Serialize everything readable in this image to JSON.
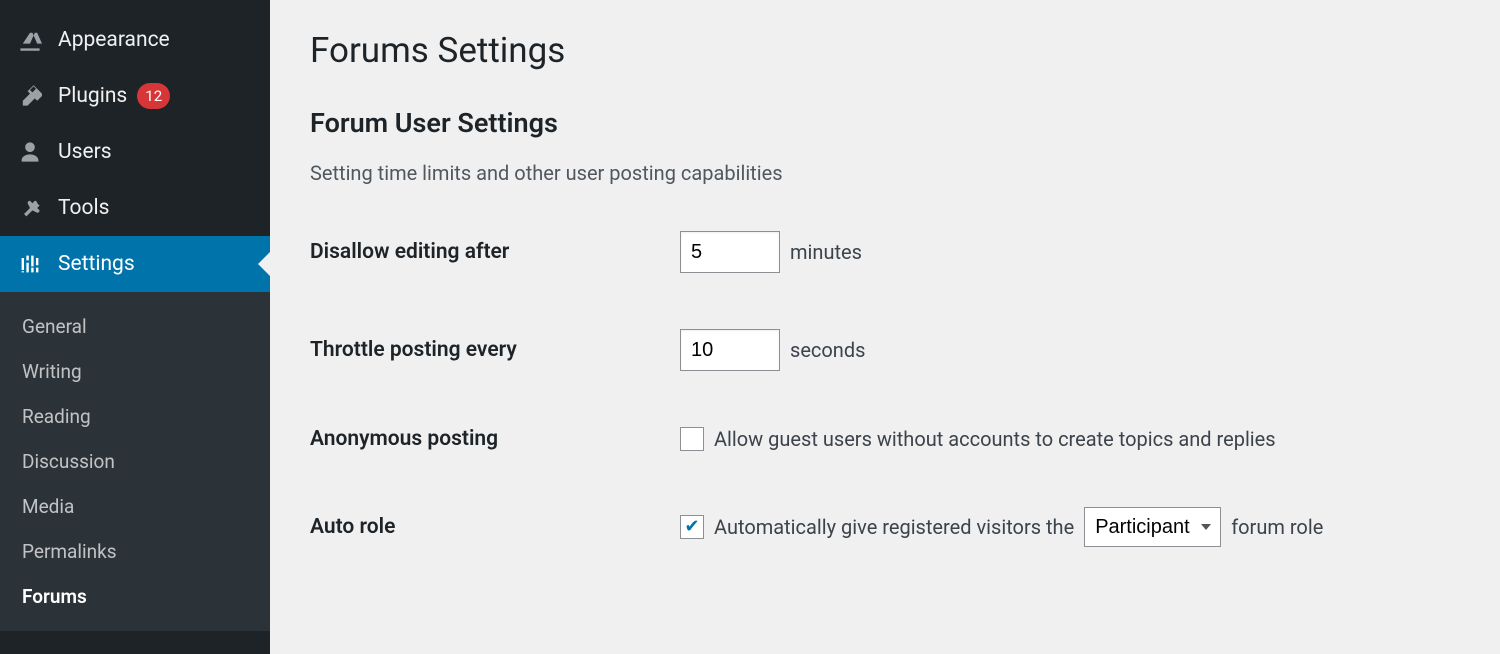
{
  "sidebar": {
    "items": [
      {
        "label": "Appearance",
        "icon": "appearance"
      },
      {
        "label": "Plugins",
        "icon": "plugins",
        "badge": "12"
      },
      {
        "label": "Users",
        "icon": "users"
      },
      {
        "label": "Tools",
        "icon": "tools"
      },
      {
        "label": "Settings",
        "icon": "settings",
        "active": true
      }
    ],
    "submenu": [
      {
        "label": "General"
      },
      {
        "label": "Writing"
      },
      {
        "label": "Reading"
      },
      {
        "label": "Discussion"
      },
      {
        "label": "Media"
      },
      {
        "label": "Permalinks"
      },
      {
        "label": "Forums",
        "current": true
      }
    ]
  },
  "page": {
    "title": "Forums Settings",
    "section_title": "Forum User Settings",
    "section_desc": "Setting time limits and other user posting capabilities"
  },
  "fields": {
    "disallow_editing": {
      "label": "Disallow editing after",
      "value": "5",
      "unit": "minutes"
    },
    "throttle_posting": {
      "label": "Throttle posting every",
      "value": "10",
      "unit": "seconds"
    },
    "anonymous": {
      "label": "Anonymous posting",
      "checkbox_label": "Allow guest users without accounts to create topics and replies",
      "checked": false
    },
    "auto_role": {
      "label": "Auto role",
      "prefix": "Automatically give registered visitors the",
      "suffix": "forum role",
      "checked": true,
      "selected": "Participant"
    }
  }
}
